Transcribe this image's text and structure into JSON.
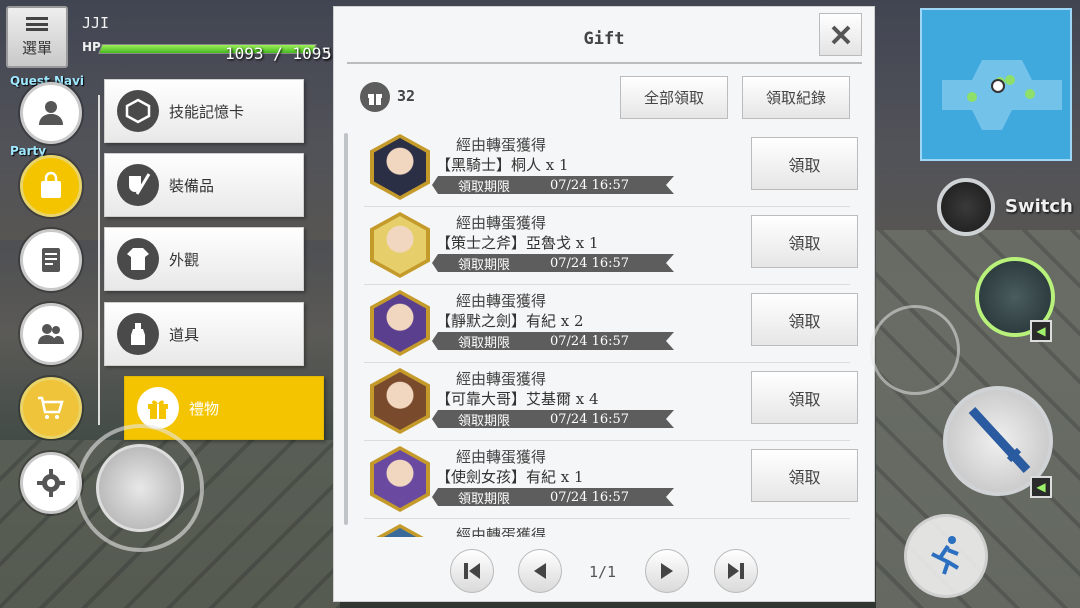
{
  "hud": {
    "menu_label": "選單",
    "player_name": "JJI",
    "hp_label": "HP",
    "hp_text": "1093 / 1093",
    "hp_fraction": 1.0,
    "hp_extra": "5",
    "quest_tag": "Quest Navi",
    "party_tag": "Party"
  },
  "side_menu": {
    "items": [
      {
        "icon": "user-icon",
        "active": false
      },
      {
        "icon": "shopping-bag-icon",
        "active": true
      },
      {
        "icon": "notepad-icon",
        "active": false
      },
      {
        "icon": "friends-icon",
        "active": false
      },
      {
        "icon": "cart-icon",
        "active": false
      },
      {
        "icon": "gear-icon",
        "active": false
      }
    ]
  },
  "sub_menu": {
    "items": [
      {
        "label": "技能記憶卡",
        "icon": "memory-card-icon"
      },
      {
        "label": "裝備品",
        "icon": "equipment-icon"
      },
      {
        "label": "外觀",
        "icon": "costume-icon"
      },
      {
        "label": "道具",
        "icon": "item-bottle-icon"
      },
      {
        "label": "禮物",
        "icon": "gift-icon"
      }
    ]
  },
  "dialog": {
    "title": "Gift",
    "count": "32",
    "claim_all_label": "全部領取",
    "history_label": "領取紀錄",
    "rows": [
      {
        "source": "經由轉蛋獲得",
        "item": "【黑騎士】桐人 x 1",
        "expiry_label": "領取期限",
        "expiry": "07/24 16:57",
        "claim": "領取",
        "face_color": "#2b2f45"
      },
      {
        "source": "經由轉蛋獲得",
        "item": "【策士之斧】亞魯戈 x 1",
        "expiry_label": "領取期限",
        "expiry": "07/24 16:57",
        "claim": "領取",
        "face_color": "#e6cf6a"
      },
      {
        "source": "經由轉蛋獲得",
        "item": "【靜默之劍】有紀 x 2",
        "expiry_label": "領取期限",
        "expiry": "07/24 16:57",
        "claim": "領取",
        "face_color": "#5a3f8e"
      },
      {
        "source": "經由轉蛋獲得",
        "item": "【可靠大哥】艾基爾 x 4",
        "expiry_label": "領取期限",
        "expiry": "07/24 16:57",
        "claim": "領取",
        "face_color": "#7a4a2c"
      },
      {
        "source": "經由轉蛋獲得",
        "item": "【使劍女孩】有紀 x 1",
        "expiry_label": "領取期限",
        "expiry": "07/24 16:57",
        "claim": "領取",
        "face_color": "#6a4aa0"
      },
      {
        "source": "經由轉蛋獲得",
        "item": "",
        "expiry_label": "",
        "expiry": "",
        "claim": "",
        "face_color": "#3a6a9a"
      }
    ],
    "pagination": "1/1"
  },
  "right_hud": {
    "switch_label": "Switch"
  },
  "colors": {
    "accent": "#f4c400",
    "ribbon": "#5d5d5d",
    "minimap": "#3fa8dd"
  }
}
